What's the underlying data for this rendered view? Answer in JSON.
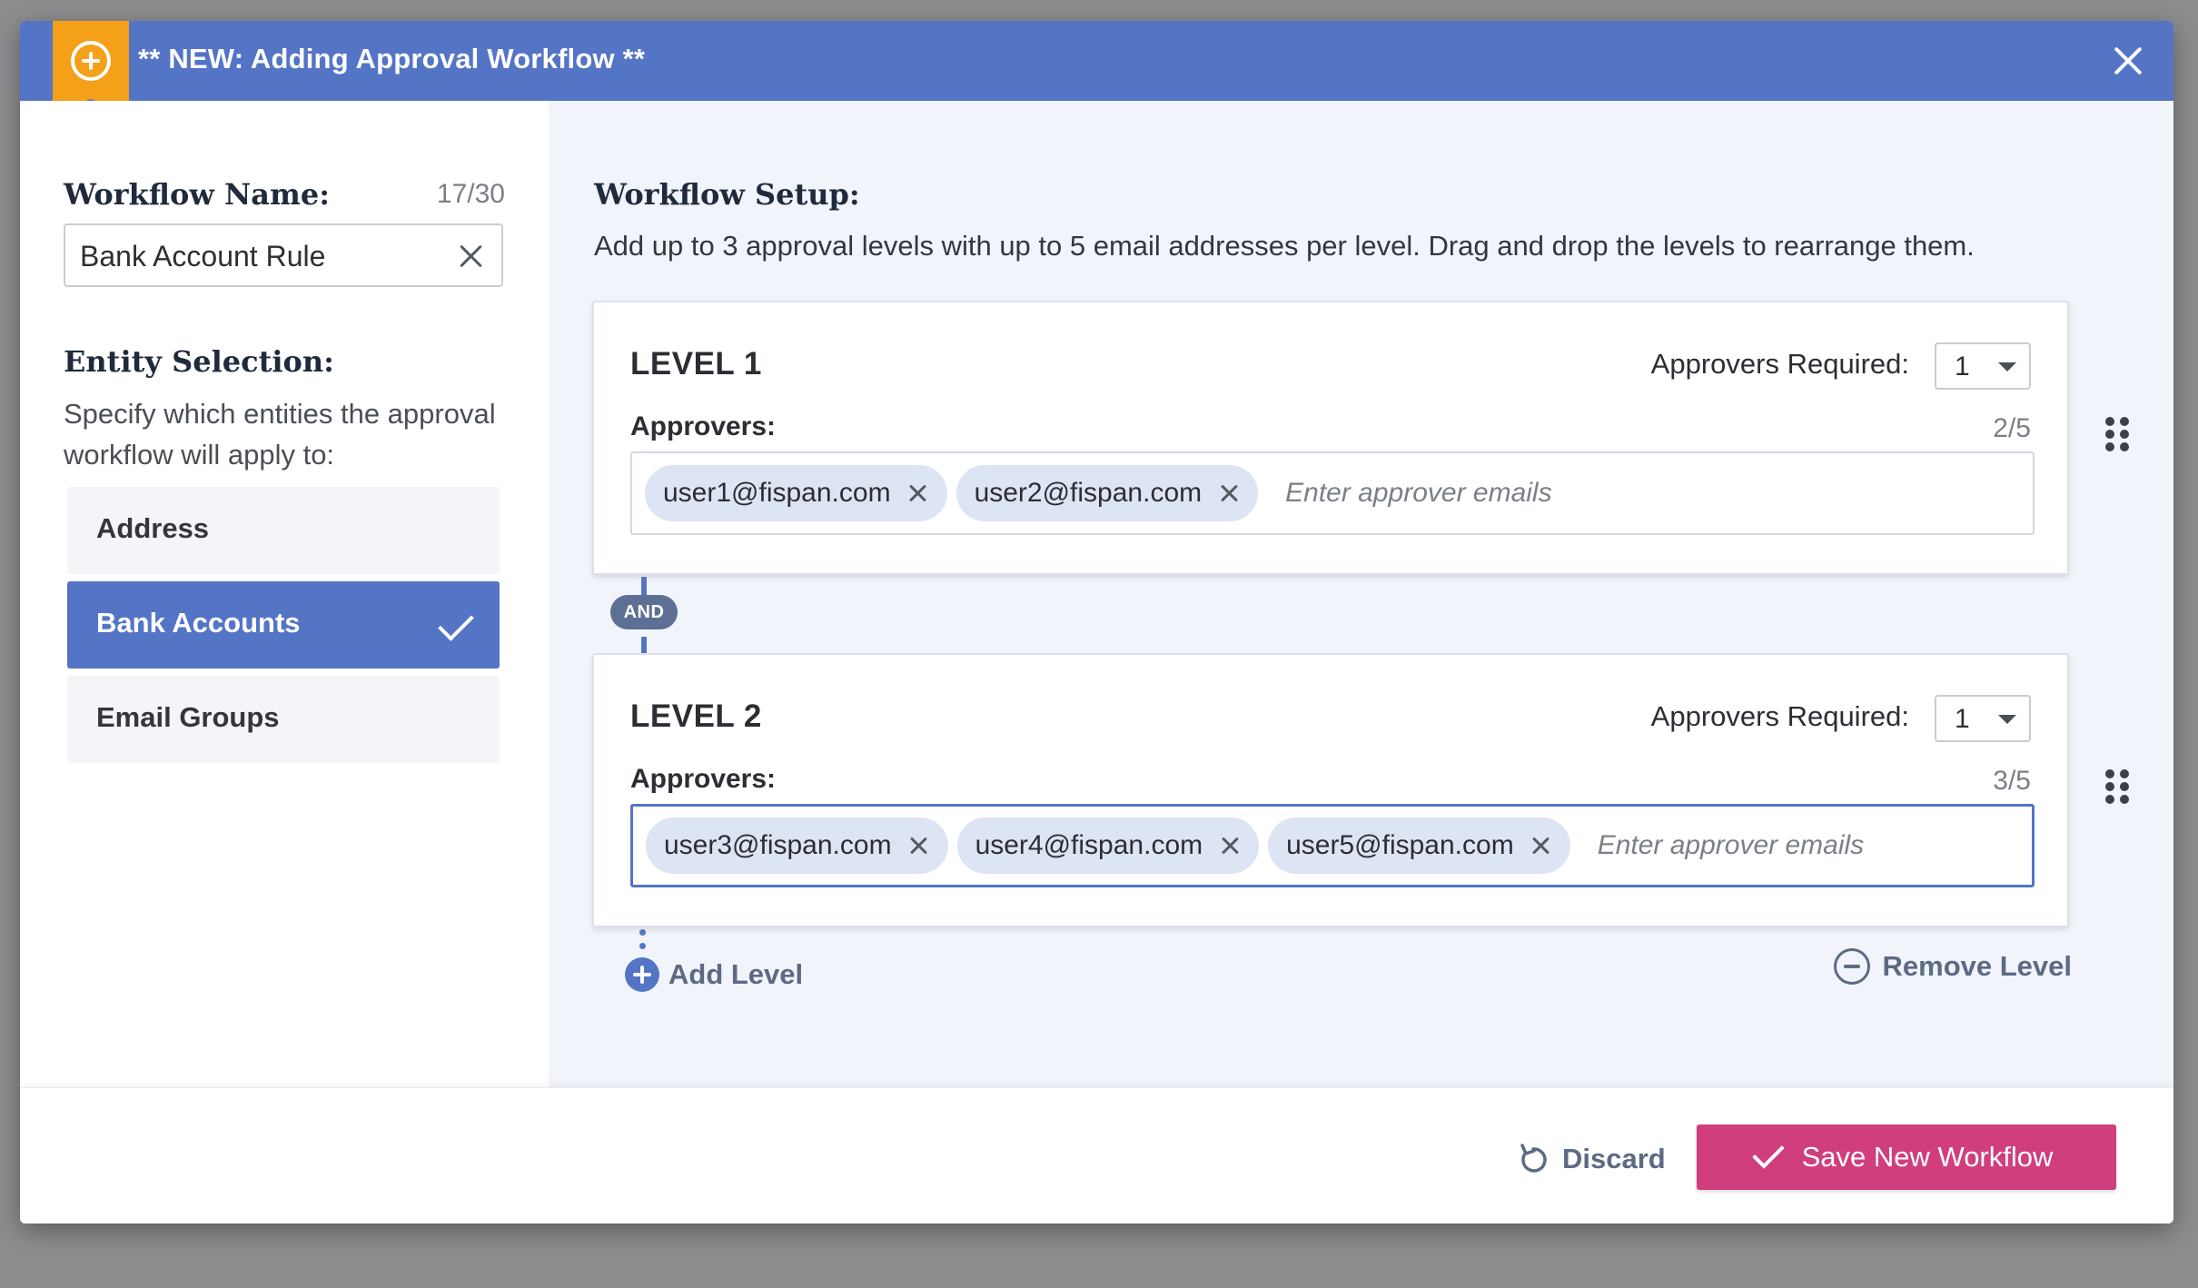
{
  "modal": {
    "title": "** NEW: Adding Approval Workflow **"
  },
  "left": {
    "workflow_name_label": "Workflow Name:",
    "workflow_name_count": "17/30",
    "workflow_name_value": "Bank Account Rule",
    "entity_selection_label": "Entity Selection:",
    "entity_selection_desc": "Specify which entities the approval workflow will apply to:",
    "entities": [
      {
        "label": "Address",
        "selected": false
      },
      {
        "label": "Bank Accounts",
        "selected": true
      },
      {
        "label": "Email Groups",
        "selected": false
      }
    ]
  },
  "right": {
    "setup_label": "Workflow Setup:",
    "setup_desc": "Add up to 3 approval levels with up to 5 email addresses per level. Drag and drop the levels to rearrange them.",
    "and_label": "AND",
    "levels": [
      {
        "title": "LEVEL 1",
        "approvers_required_label": "Approvers Required:",
        "approvers_required_value": "1",
        "approvers_label": "Approvers:",
        "approvers_count": "2/5",
        "emails": [
          "user1@fispan.com",
          "user2@fispan.com"
        ],
        "placeholder": "Enter approver emails"
      },
      {
        "title": "LEVEL 2",
        "approvers_required_label": "Approvers Required:",
        "approvers_required_value": "1",
        "approvers_label": "Approvers:",
        "approvers_count": "3/5",
        "emails": [
          "user3@fispan.com",
          "user4@fispan.com",
          "user5@fispan.com"
        ],
        "placeholder": "Enter approver emails"
      }
    ],
    "add_level_label": "Add Level",
    "remove_level_label": "Remove Level"
  },
  "footer": {
    "discard_label": "Discard",
    "save_label": "Save New Workflow"
  },
  "colors": {
    "header": "#5474c6",
    "badge": "#f5a019",
    "primary_action": "#d03e7d",
    "selected_entity": "#5474c6"
  }
}
